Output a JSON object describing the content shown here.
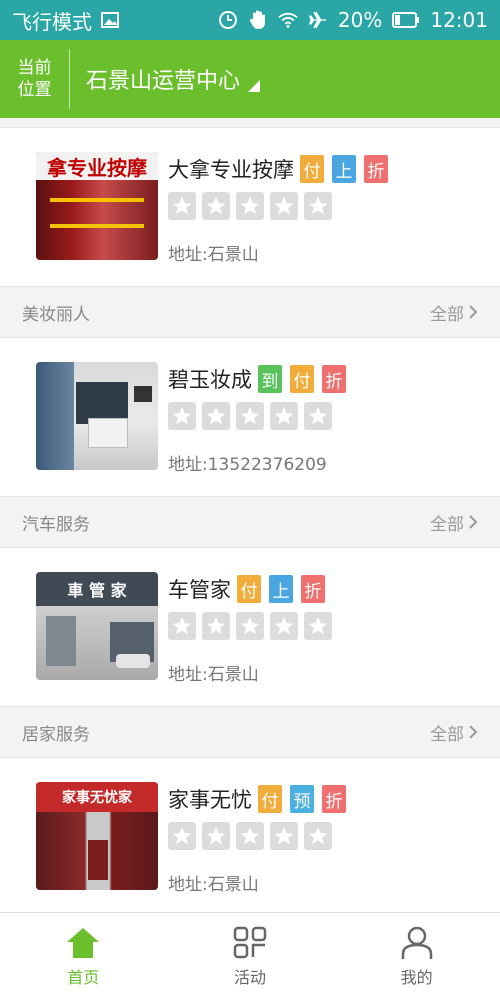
{
  "status": {
    "mode": "飞行模式",
    "battery": "20%",
    "time": "12:01"
  },
  "location": {
    "label_line1": "当前",
    "label_line2": "位置",
    "place": "石景山运营中心"
  },
  "sections": [
    {
      "title": "美妆丽人",
      "all_label": "全部",
      "item": {
        "name": "碧玉妆成",
        "tags": [
          {
            "t": "到",
            "c": "#5ac25a"
          },
          {
            "t": "付",
            "c": "#f0ad3c"
          },
          {
            "t": "折",
            "c": "#f07070"
          }
        ],
        "address": "地址:13522376209"
      }
    },
    {
      "title": "汽车服务",
      "all_label": "全部",
      "item": {
        "name": "车管家",
        "tags": [
          {
            "t": "付",
            "c": "#f0ad3c"
          },
          {
            "t": "上",
            "c": "#4aa6e0"
          },
          {
            "t": "折",
            "c": "#f07070"
          }
        ],
        "address": "地址:石景山"
      }
    },
    {
      "title": "居家服务",
      "all_label": "全部",
      "item": {
        "name": "家事无忧",
        "tags": [
          {
            "t": "付",
            "c": "#f0ad3c"
          },
          {
            "t": "预",
            "c": "#4ab0e0"
          },
          {
            "t": "折",
            "c": "#f07070"
          }
        ],
        "address": "地址:石景山"
      }
    }
  ],
  "first_item": {
    "name": "大拿专业按摩",
    "tags": [
      {
        "t": "付",
        "c": "#f0ad3c"
      },
      {
        "t": "上",
        "c": "#4aa6e0"
      },
      {
        "t": "折",
        "c": "#f07070"
      }
    ],
    "address": "地址:石景山"
  },
  "thumb_texts": {
    "first": "拿专业按摩",
    "car": "車 管 家",
    "home": "家事无忧家"
  },
  "tabs": [
    {
      "label": "首页",
      "icon": "home-icon",
      "active": true
    },
    {
      "label": "活动",
      "icon": "grid-icon",
      "active": false
    },
    {
      "label": "我的",
      "icon": "person-icon",
      "active": false
    }
  ],
  "colors": {
    "status_bg": "#2aa6a6",
    "header_bg": "#6bbf2d",
    "accent": "#6bbf2d"
  }
}
